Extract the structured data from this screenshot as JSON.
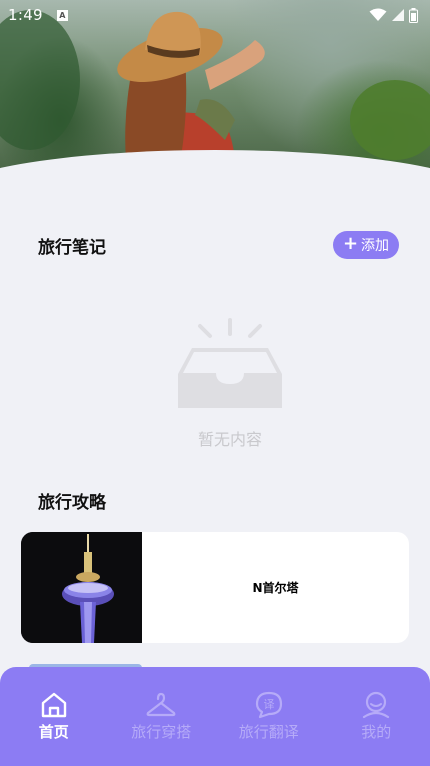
{
  "status_bar": {
    "time": "1:49",
    "notification_badge": "A"
  },
  "notes_section": {
    "title": "旅行笔记",
    "add_button_label": "添加",
    "empty_text": "暂无内容"
  },
  "guides_section": {
    "title": "旅行攻略",
    "items": [
      {
        "name": "N首尔塔"
      }
    ]
  },
  "tab_bar": {
    "tabs": [
      {
        "label": "首页",
        "icon": "home-icon",
        "active": true
      },
      {
        "label": "旅行穿搭",
        "icon": "hanger-icon",
        "active": false
      },
      {
        "label": "旅行翻译",
        "icon": "translate-chat-icon",
        "active": false
      },
      {
        "label": "我的",
        "icon": "profile-icon",
        "active": false
      }
    ]
  },
  "colors": {
    "accent": "#8c7cf3",
    "background": "#f0f1f6",
    "tab_inactive": "#b6abf8",
    "empty_gray": "#c9c9cd"
  }
}
